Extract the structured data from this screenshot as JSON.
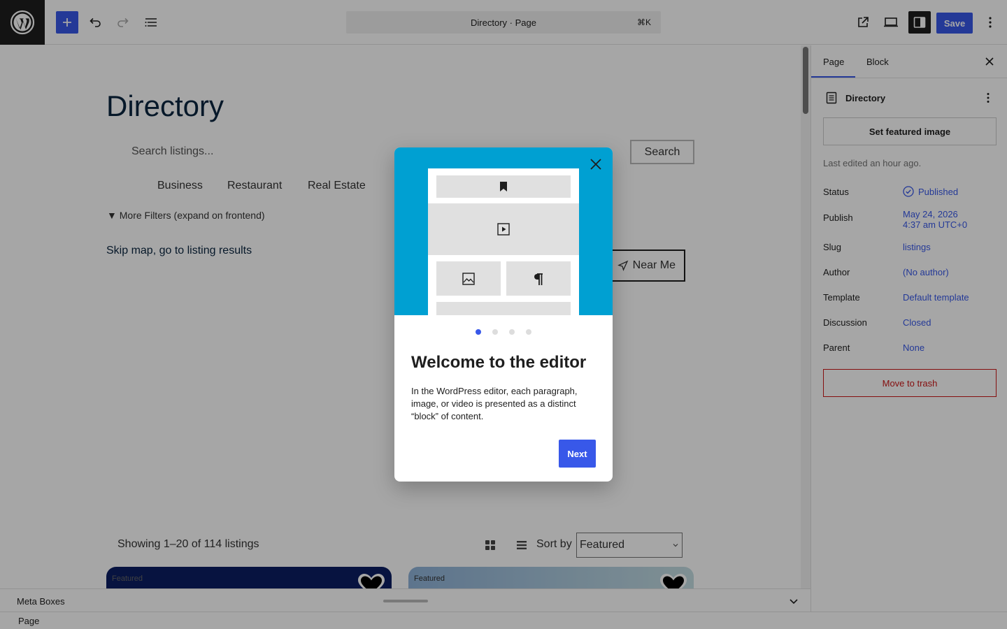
{
  "topbar": {
    "doc_title": "Directory · Page",
    "shortcut": "⌘K",
    "save_label": "Save"
  },
  "canvas": {
    "page_title": "Directory",
    "search_placeholder": "Search listings...",
    "search_button": "Search",
    "categories": [
      "Business",
      "Restaurant",
      "Real Estate"
    ],
    "filters_toggle": "▼ More Filters (expand on frontend)",
    "skip_link": "Skip map, go to listing results",
    "near_me": "Near Me",
    "showing": "Showing 1–20 of 114 listings",
    "sort_label": "Sort by",
    "sort_value": "Featured",
    "cards": [
      {
        "badge": "Featured"
      },
      {
        "badge": "Featured"
      }
    ]
  },
  "metabox": {
    "label": "Meta Boxes"
  },
  "footer": {
    "breadcrumb": "Page"
  },
  "sidebar": {
    "tabs": [
      "Page",
      "Block"
    ],
    "doc_title": "Directory",
    "featured_image": "Set featured image",
    "last_edited": "Last edited an hour ago.",
    "rows": [
      {
        "label": "Status",
        "value": "Published"
      },
      {
        "label": "Publish",
        "value": "May 24, 2026",
        "value2": "4:37 am UTC+0"
      },
      {
        "label": "Slug",
        "value": "listings"
      },
      {
        "label": "Author",
        "value": "(No author)"
      },
      {
        "label": "Template",
        "value": "Default template"
      },
      {
        "label": "Discussion",
        "value": "Closed"
      },
      {
        "label": "Parent",
        "value": "None"
      }
    ],
    "trash": "Move to trash"
  },
  "modal": {
    "heading": "Welcome to the editor",
    "text": "In the WordPress editor, each paragraph, image, or video is presented as a distinct “block” of content.",
    "next": "Next",
    "pages_total": 4,
    "current_page": 1
  },
  "colors": {
    "accent": "#3858e9",
    "illustration_bg": "#00a0d2",
    "danger": "#cc1818"
  }
}
